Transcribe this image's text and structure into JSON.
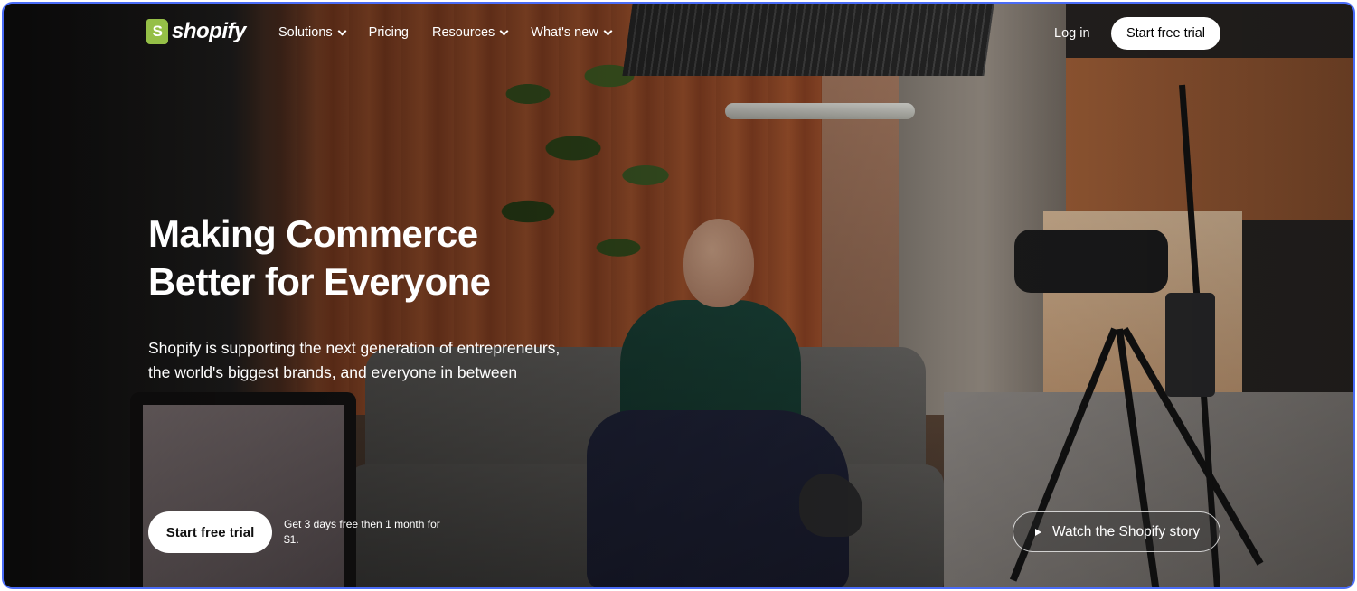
{
  "header": {
    "brand": "shopify",
    "logo_glyph": "S",
    "nav": [
      {
        "label": "Solutions",
        "has_dropdown": true
      },
      {
        "label": "Pricing",
        "has_dropdown": false
      },
      {
        "label": "Resources",
        "has_dropdown": true
      },
      {
        "label": "What's new",
        "has_dropdown": true
      }
    ],
    "login_label": "Log in",
    "trial_label": "Start free trial"
  },
  "hero": {
    "title_lines": [
      "Making Commerce",
      "Better for Everyone"
    ],
    "subtitle_lines": [
      "Shopify is supporting the next generation of entrepreneurs,",
      "the world's biggest brands, and everyone in between"
    ],
    "cta_label": "Start free trial",
    "offer_text": "Get 3 days free then 1 month for $1.",
    "watch_label": "Watch the Shopify story"
  },
  "colors": {
    "brand_green": "#95bf47",
    "frame_border": "#4a6cf7",
    "button_bg": "#ffffff"
  },
  "icons": {
    "logo": "shopping-bag-icon",
    "dropdown": "chevron-down-icon",
    "play": "play-icon"
  }
}
